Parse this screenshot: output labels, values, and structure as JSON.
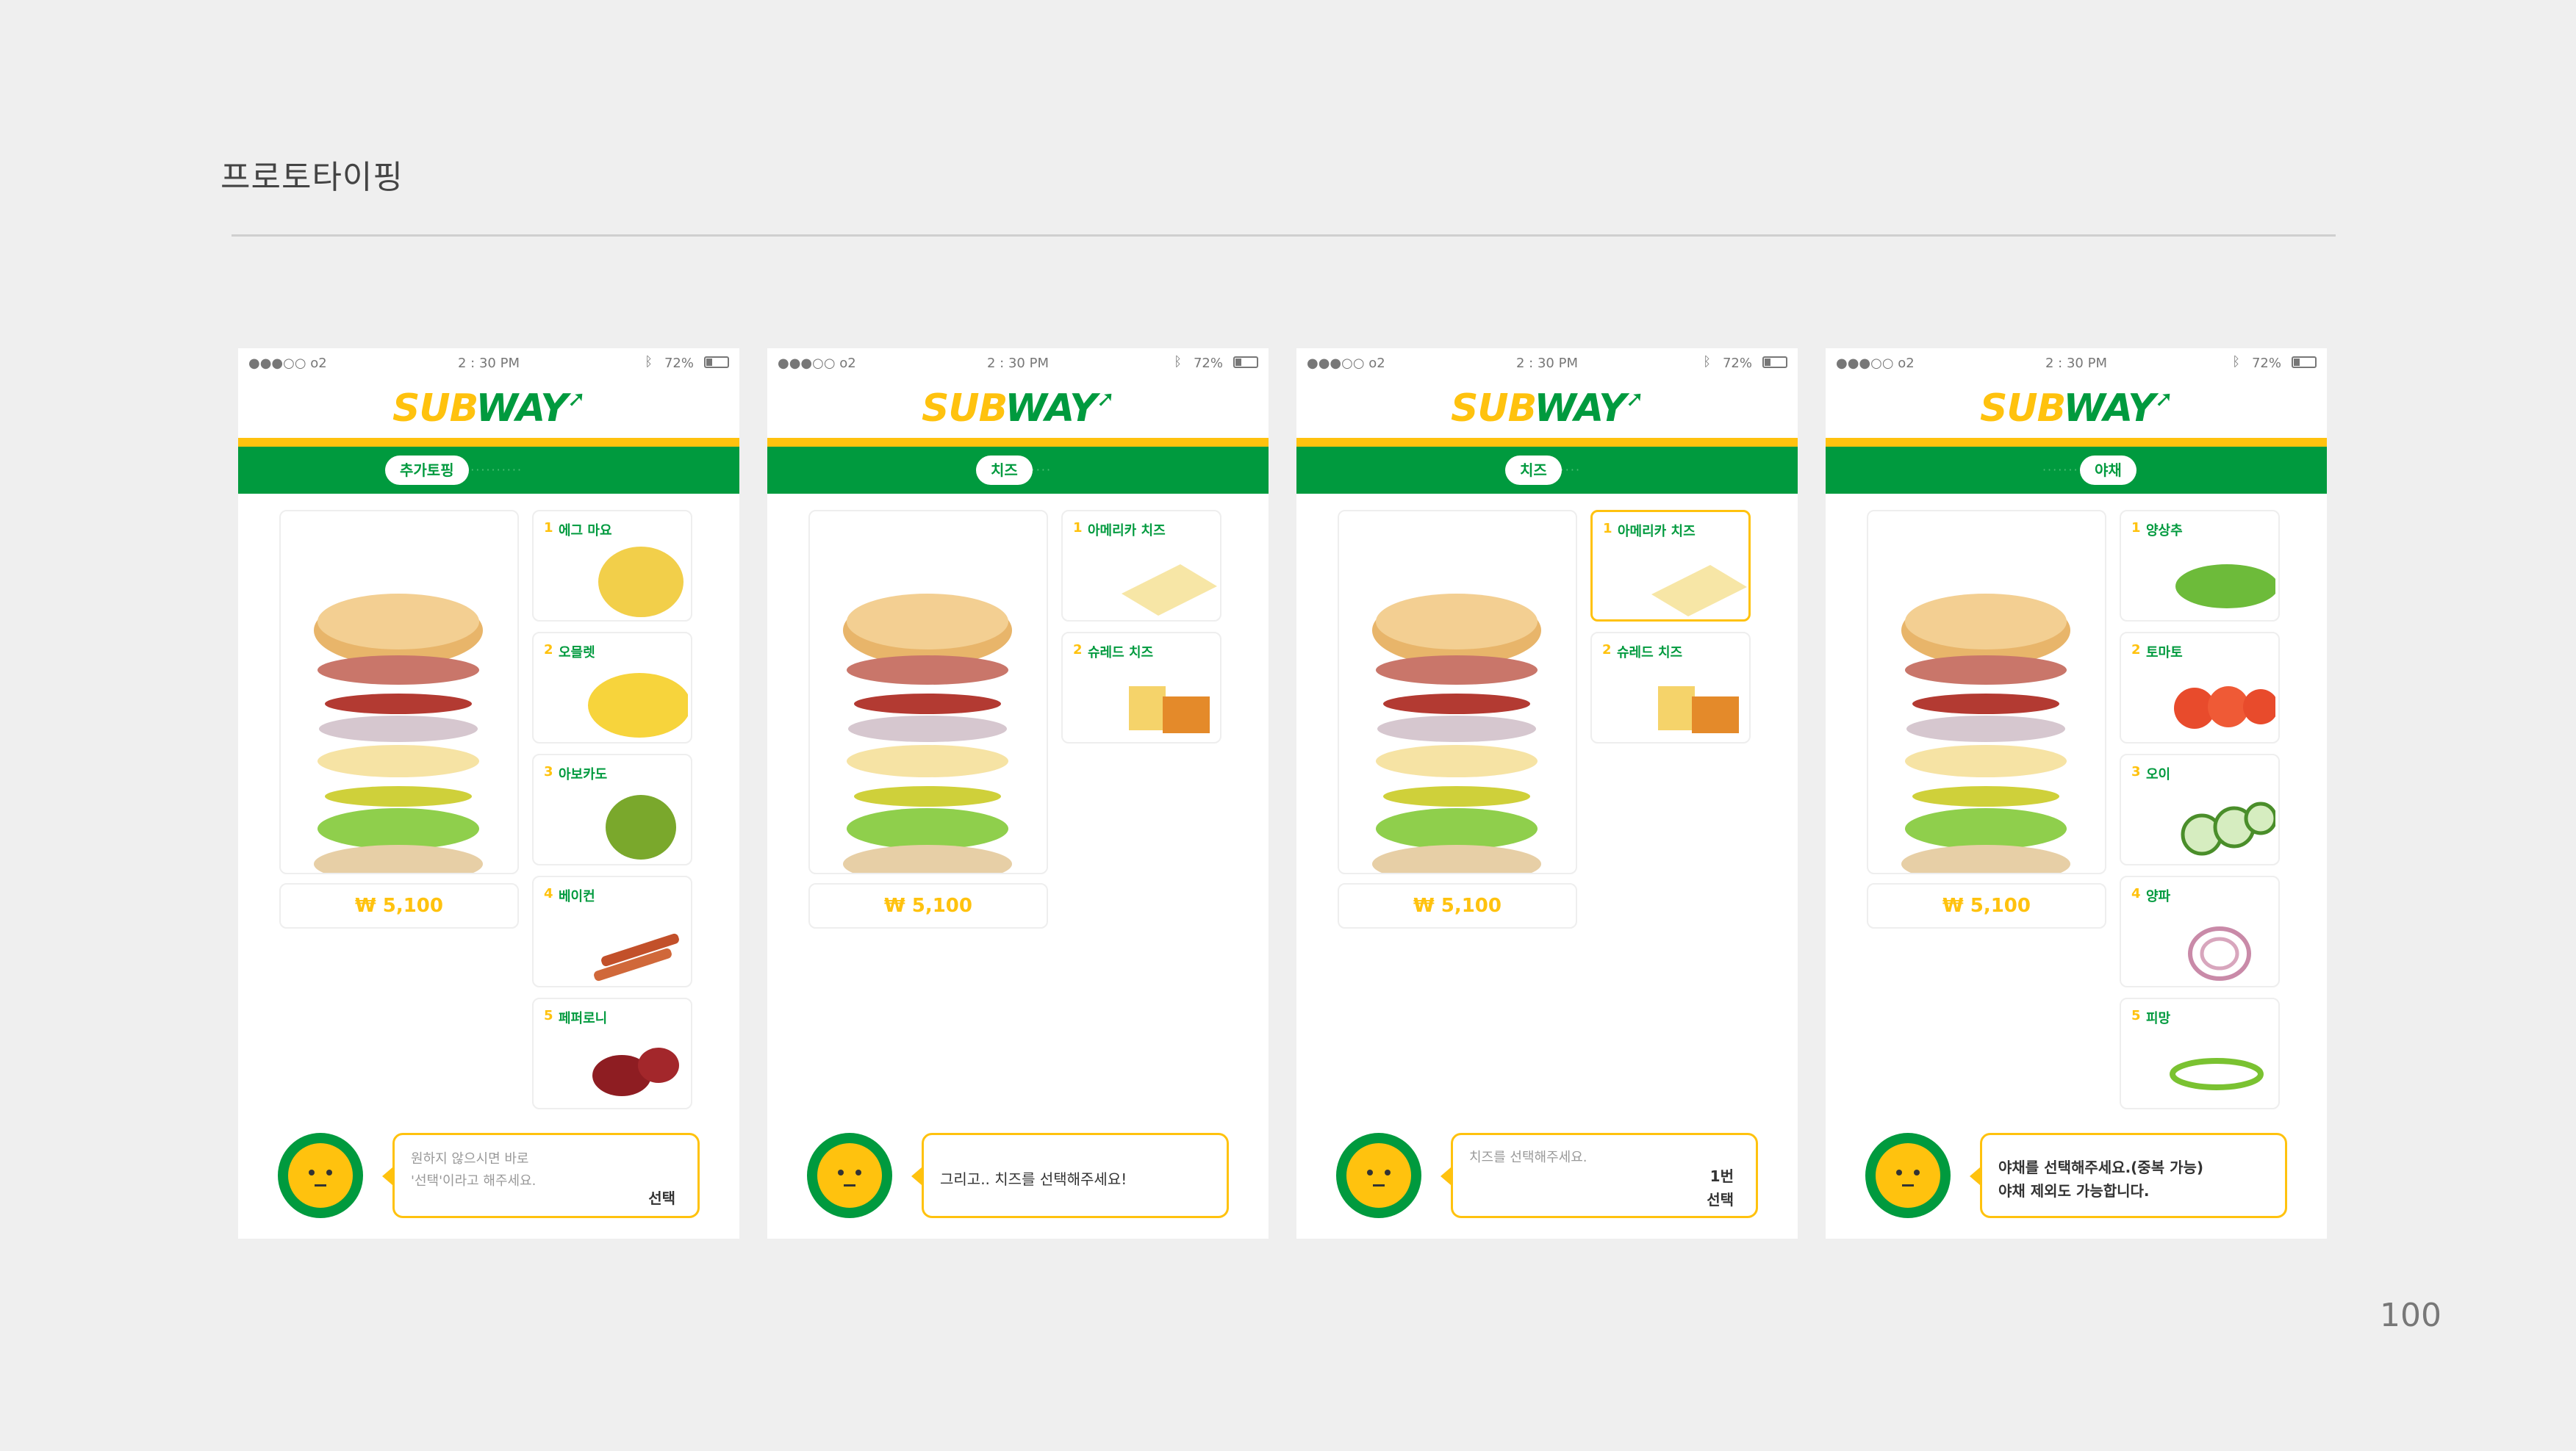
{
  "page": {
    "heading": "프로토타이핑",
    "page_number": "100"
  },
  "status_bar": {
    "carrier": "●●●○○ o2",
    "time": "2 : 30 PM",
    "battery": "72%"
  },
  "logo": {
    "sub": "SUB",
    "way": "WAY",
    "mark": "➚"
  },
  "step_trail": "·············",
  "phones": [
    {
      "step": "추가토핑",
      "price": "₩ 5,100",
      "options": [
        {
          "num": "1",
          "label": "에그 마요"
        },
        {
          "num": "2",
          "label": "오믈렛"
        },
        {
          "num": "3",
          "label": "아보카도"
        },
        {
          "num": "4",
          "label": "베이컨"
        },
        {
          "num": "5",
          "label": "페퍼로니"
        }
      ],
      "bubble": {
        "line1": "원하지 않으시면 바로",
        "line2": "'선택'이라고 해주세요.",
        "action": "선택"
      }
    },
    {
      "step": "치즈",
      "price": "₩ 5,100",
      "options": [
        {
          "num": "1",
          "label": "아메리카 치즈"
        },
        {
          "num": "2",
          "label": "슈레드 치즈"
        }
      ],
      "bubble": {
        "line1": "그리고.. 치즈를 선택해주세요!"
      }
    },
    {
      "step": "치즈",
      "price": "₩ 5,100",
      "options": [
        {
          "num": "1",
          "label": "아메리카 치즈"
        },
        {
          "num": "2",
          "label": "슈레드 치즈"
        }
      ],
      "bubble": {
        "placeholder": "치즈를 선택해주세요.",
        "action_line1": "1번",
        "action_line2": "선택"
      }
    },
    {
      "step": "야채",
      "price": "₩ 5,100",
      "options": [
        {
          "num": "1",
          "label": "양상추"
        },
        {
          "num": "2",
          "label": "토마토"
        },
        {
          "num": "3",
          "label": "오이"
        },
        {
          "num": "4",
          "label": "양파"
        },
        {
          "num": "5",
          "label": "피망"
        }
      ],
      "bubble": {
        "line1": "야채를 선택해주세요.(중복 가능)",
        "line2": "야채 제외도 가능합니다."
      }
    }
  ],
  "colors": {
    "brand_green": "#009a3e",
    "brand_yellow": "#ffc20e",
    "background": "#efefef"
  },
  "icons": {
    "wifi": "wifi-icon",
    "bluetooth": "bluetooth-icon",
    "battery": "battery-icon",
    "mascot": "mascot-face-icon"
  }
}
